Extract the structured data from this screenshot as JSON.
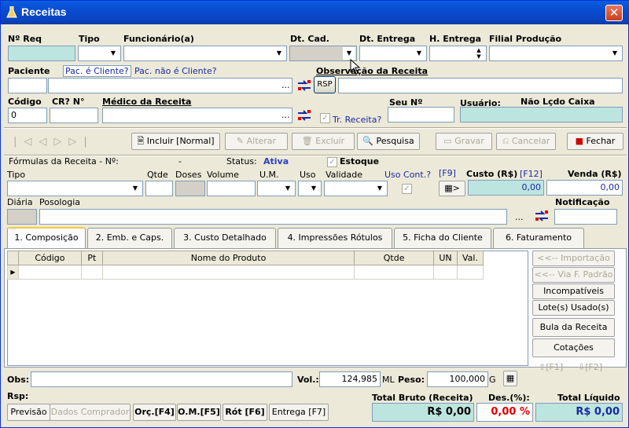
{
  "window": {
    "title": "Receitas",
    "close": "✕"
  },
  "header": {
    "nr_req": "Nº Req",
    "tipo": "Tipo",
    "funcionario": "Funcionário(a)",
    "dt_cad": "Dt. Cad.",
    "dt_entrega": "Dt. Entrega",
    "h_entrega": "H. Entrega",
    "filial": "Filial Produção",
    "paciente": "Paciente",
    "pac_cliente": "Pac. é Cliente?",
    "pac_nao_cliente": "Pac. não é Cliente?",
    "obs_receita": "Observação da Receita",
    "rsp": "RSP",
    "codigo": "Código",
    "cr_n": "CR? N°",
    "medico": "Médico da Receita",
    "seu_n": "Seu Nº",
    "usuario": "Usuário:",
    "nao_lcdo": "Não Lçdo Caixa",
    "tr_receita": "Tr. Receita?",
    "codigo_value": "0",
    "ellipsis": "..."
  },
  "toolbar": {
    "incluir": "Incluir [Normal]",
    "alterar": "Alterar",
    "excluir": "Excluir",
    "pesquisa": "Pesquisa",
    "gravar": "Gravar",
    "cancelar": "Cancelar",
    "fechar": "Fechar"
  },
  "formulas": {
    "title": "Fórmulas da Receita - Nº:",
    "dash": "-",
    "status_label": "Status:",
    "status_value": "Ativa",
    "estoque": "Estoque",
    "tipo": "Tipo",
    "qtde": "Qtde",
    "doses": "Doses",
    "volume": "Volume",
    "um": "U.M.",
    "uso": "Uso",
    "validade": "Validade",
    "uso_cont": "Uso Cont.?",
    "f9": "[F9]",
    "custo": "Custo (R$)",
    "f12": "[F12]",
    "venda": "Venda (R$)",
    "custo_value": "0,00",
    "venda_value": "0,00",
    "diaria": "Diária",
    "posologia": "Posologia",
    "notificacao": "Notificação",
    "f9btn": ">",
    "ellipsis": "..."
  },
  "tabs": [
    "1. Composição",
    "2. Emb. e Caps.",
    "3. Custo Detalhado",
    "4. Impressões Rótulos",
    "5. Ficha do Cliente",
    "6. Faturamento"
  ],
  "grid": {
    "columns": [
      "Código",
      "Pt",
      "Nome do Produto",
      "Qtde",
      "UN",
      "Val."
    ],
    "row_marker": "▶"
  },
  "side_buttons": {
    "importacao": "<<-- Importação",
    "via_padrao": "<<-- Via F. Padrão",
    "incompativeis": "Incompatíveis",
    "lotes": "Lote(s) Usado(s)",
    "bula": "Bula da Receita",
    "cotacoes": "Cotações",
    "f1": "[F1]",
    "f2": "[F2]"
  },
  "footer": {
    "obs": "Obs:",
    "vol": "Vol.:",
    "vol_value": "124,985",
    "ml": "ML",
    "peso": "Peso:",
    "peso_value": "100,000",
    "g": "G",
    "rsp": "Rsp:",
    "total_bruto": "Total Bruto (Receita)",
    "des": "Des.(%):",
    "total_liquido": "Total Líquido",
    "total_bruto_value": "R$ 0,00",
    "des_value": "0,00 %",
    "total_liquido_value": "R$ 0,00",
    "previsao": "Previsão",
    "dados_comprador": "Dados Comprador",
    "orc": "Orç.[F4]",
    "om": "O.M.[F5]",
    "rot": "Rót [F6]",
    "entrega": "Entrega [F7]"
  },
  "colors": {
    "titlebar": "#0a4cd0",
    "teal_field": "#bde5e0",
    "status": "#2b3fbf",
    "red": "#e00000",
    "blue_value": "#1a2aa0"
  }
}
